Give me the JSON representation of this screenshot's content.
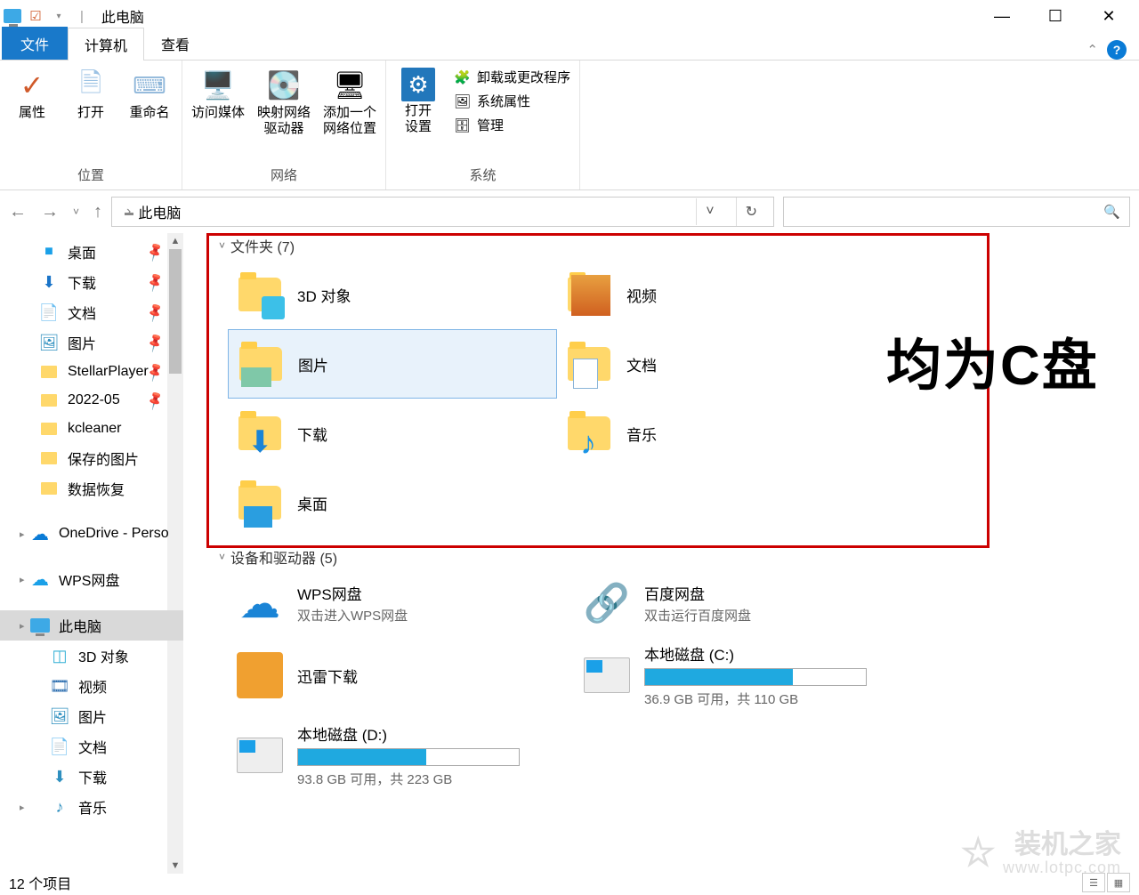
{
  "titlebar": {
    "title": "此电脑"
  },
  "win_controls": {
    "min": "—",
    "max": "☐",
    "close": "✕"
  },
  "ribbon_tabs": {
    "file": "文件",
    "computer": "计算机",
    "view": "查看"
  },
  "ribbon": {
    "location_group": "位置",
    "network_group": "网络",
    "system_group": "系统",
    "properties": "属性",
    "open": "打开",
    "rename": "重命名",
    "media": "访问媒体",
    "map_drive": "映射网络\n驱动器",
    "add_location": "添加一个\n网络位置",
    "open_settings": "打开\n设置",
    "uninstall": "卸载或更改程序",
    "sys_props": "系统属性",
    "manage": "管理"
  },
  "address": {
    "location": "此电脑"
  },
  "sidebar": {
    "items": [
      {
        "label": "桌面",
        "pin": true
      },
      {
        "label": "下载",
        "pin": true
      },
      {
        "label": "文档",
        "pin": true
      },
      {
        "label": "图片",
        "pin": true
      },
      {
        "label": "StellarPlayer",
        "pin": true
      },
      {
        "label": "2022-05",
        "pin": true
      },
      {
        "label": "kcleaner"
      },
      {
        "label": "保存的图片"
      },
      {
        "label": "数据恢复"
      },
      {
        "label": "OneDrive - Perso",
        "icon": "cloud-blue",
        "tri": true
      },
      {
        "label": "WPS网盘",
        "icon": "cloud-blue2",
        "tri": true
      },
      {
        "label": "此电脑",
        "icon": "pc",
        "selected": true,
        "tri": true
      },
      {
        "label": "3D 对象",
        "icon": "3d"
      },
      {
        "label": "视频",
        "icon": "video"
      },
      {
        "label": "图片",
        "icon": "pictures"
      },
      {
        "label": "文档",
        "icon": "docs"
      },
      {
        "label": "下载",
        "icon": "downloads"
      },
      {
        "label": "音乐",
        "icon": "music",
        "tri": true
      }
    ]
  },
  "sections": {
    "folders_header": "文件夹 (7)",
    "devices_header": "设备和驱动器 (5)"
  },
  "folders": [
    {
      "label": "3D 对象"
    },
    {
      "label": "视频"
    },
    {
      "label": "图片",
      "selected": true
    },
    {
      "label": "文档"
    },
    {
      "label": "下载"
    },
    {
      "label": "音乐"
    },
    {
      "label": "桌面"
    }
  ],
  "devices": [
    {
      "title": "WPS网盘",
      "sub": "双击进入WPS网盘",
      "icon": "wps"
    },
    {
      "title": "百度网盘",
      "sub": "双击运行百度网盘",
      "icon": "baidu"
    },
    {
      "title": "迅雷下载",
      "sub": "",
      "icon": "xunlei"
    },
    {
      "title": "本地磁盘 (C:)",
      "sub": "36.9 GB 可用，共 110 GB",
      "icon": "disk",
      "fill": 67
    },
    {
      "title": "本地磁盘 (D:)",
      "sub": "93.8 GB 可用，共 223 GB",
      "icon": "disk",
      "fill": 58
    }
  ],
  "annotation": "均为C盘",
  "statusbar": {
    "count": "12 个项目"
  },
  "watermark": {
    "main": "装机之家",
    "sub": "www.lotpc.com"
  }
}
